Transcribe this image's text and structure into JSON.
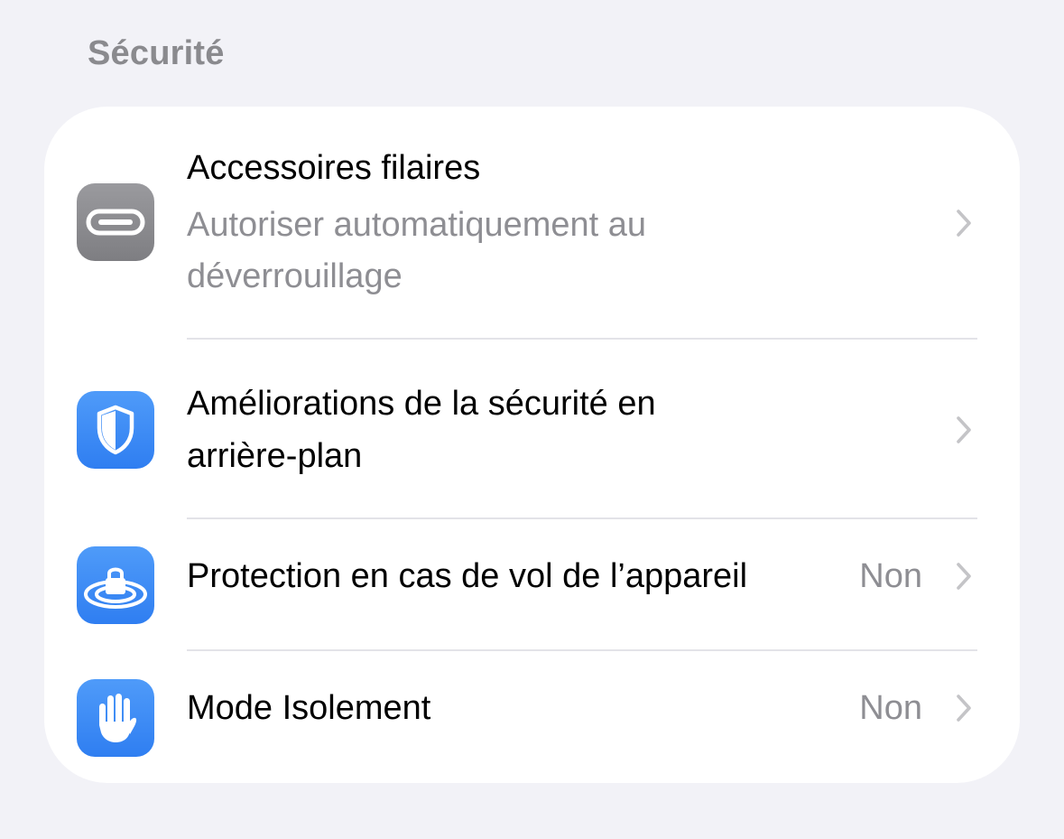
{
  "section": {
    "header": "Sécurité"
  },
  "rows": [
    {
      "title": "Accessoires filaires",
      "subtitle_line1": "Autoriser automatiquement au",
      "subtitle_line2": "déverrouillage",
      "icon": "usb-c-connector-icon",
      "icon_color": "#8e8e93"
    },
    {
      "title_line1": "Améliorations de la sécurité en",
      "title_line2": "arrière-plan",
      "icon": "shield-icon",
      "icon_color": "#3a86f4"
    },
    {
      "title": "Protection en cas de vol de l’appareil",
      "value": "Non",
      "icon": "lock-rings-icon",
      "icon_color": "#3a86f4"
    },
    {
      "title": "Mode Isolement",
      "value": "Non",
      "icon": "raised-hand-icon",
      "icon_color": "#3a86f4"
    }
  ],
  "colors": {
    "background": "#f2f2f7",
    "card": "#ffffff",
    "secondary_text": "#8e8e93",
    "chevron": "#c4c4c7"
  }
}
